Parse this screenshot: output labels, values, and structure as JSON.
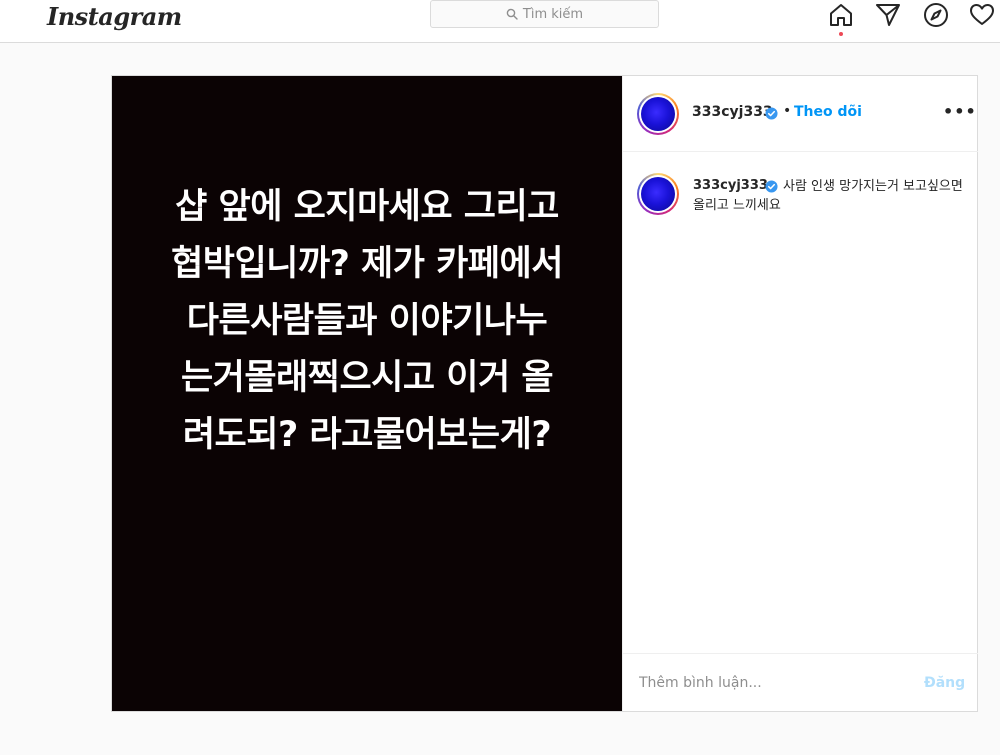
{
  "app": {
    "logo": "Instagram"
  },
  "search": {
    "placeholder": "Tìm kiếm"
  },
  "nav": {
    "icons": [
      "home-icon",
      "direct-icon",
      "explore-icon",
      "heart-icon"
    ]
  },
  "post": {
    "image_text": "샵 앞에 오지마세요 그리고\n협박입니까? 제가 카페에서\n다른사람들과 이야기나누\n는거몰래찍으시고 이거 올\n려도되? 라고물어보는게?",
    "author": {
      "username": "333cyj333",
      "verified": true,
      "follow_label": "Theo dõi",
      "separator": "•"
    },
    "more_label": "•••",
    "caption": {
      "username": "333cyj333",
      "text": "사람 인생 망가지는거 보고싶으면 올리고 느끼세요"
    },
    "comment": {
      "placeholder": "Thêm bình luận...",
      "post_label": "Đăng"
    }
  },
  "colors": {
    "accent": "#0095f6",
    "accent_disabled": "#b2dffc",
    "notification": "#ed4956",
    "media_background": "#0b0304"
  }
}
